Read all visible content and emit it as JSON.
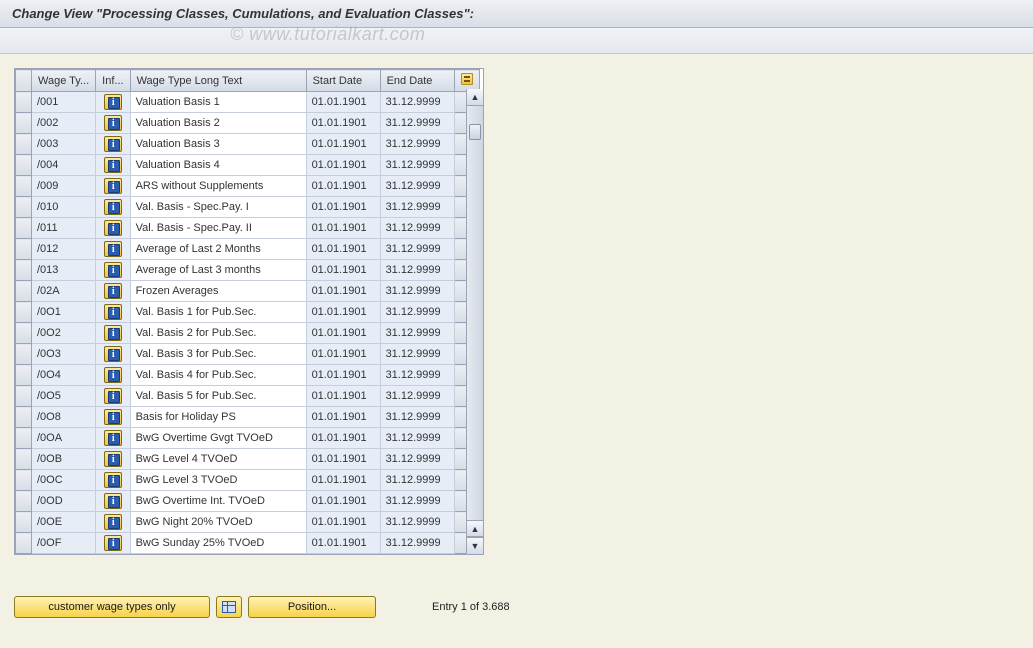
{
  "title": "Change View \"Processing Classes, Cumulations, and Evaluation Classes\":",
  "watermark": "© www.tutorialkart.com",
  "columns": {
    "wage_type": "Wage Ty...",
    "info": "Inf...",
    "long_text": "Wage Type Long Text",
    "start_date": "Start Date",
    "end_date": "End Date"
  },
  "rows": [
    {
      "wt": "/001",
      "txt": "Valuation Basis 1",
      "sd": "01.01.1901",
      "ed": "31.12.9999"
    },
    {
      "wt": "/002",
      "txt": "Valuation Basis 2",
      "sd": "01.01.1901",
      "ed": "31.12.9999"
    },
    {
      "wt": "/003",
      "txt": "Valuation Basis 3",
      "sd": "01.01.1901",
      "ed": "31.12.9999"
    },
    {
      "wt": "/004",
      "txt": "Valuation Basis 4",
      "sd": "01.01.1901",
      "ed": "31.12.9999"
    },
    {
      "wt": "/009",
      "txt": "ARS without Supplements",
      "sd": "01.01.1901",
      "ed": "31.12.9999"
    },
    {
      "wt": "/010",
      "txt": "Val. Basis - Spec.Pay. I",
      "sd": "01.01.1901",
      "ed": "31.12.9999"
    },
    {
      "wt": "/011",
      "txt": "Val. Basis - Spec.Pay. II",
      "sd": "01.01.1901",
      "ed": "31.12.9999"
    },
    {
      "wt": "/012",
      "txt": "Average of Last 2 Months",
      "sd": "01.01.1901",
      "ed": "31.12.9999"
    },
    {
      "wt": "/013",
      "txt": "Average of Last 3 months",
      "sd": "01.01.1901",
      "ed": "31.12.9999"
    },
    {
      "wt": "/02A",
      "txt": "Frozen Averages",
      "sd": "01.01.1901",
      "ed": "31.12.9999"
    },
    {
      "wt": "/0O1",
      "txt": "Val. Basis 1 for Pub.Sec.",
      "sd": "01.01.1901",
      "ed": "31.12.9999"
    },
    {
      "wt": "/0O2",
      "txt": "Val. Basis 2 for Pub.Sec.",
      "sd": "01.01.1901",
      "ed": "31.12.9999"
    },
    {
      "wt": "/0O3",
      "txt": "Val. Basis 3 for Pub.Sec.",
      "sd": "01.01.1901",
      "ed": "31.12.9999"
    },
    {
      "wt": "/0O4",
      "txt": "Val. Basis 4 for Pub.Sec.",
      "sd": "01.01.1901",
      "ed": "31.12.9999"
    },
    {
      "wt": "/0O5",
      "txt": "Val. Basis 5 for Pub.Sec.",
      "sd": "01.01.1901",
      "ed": "31.12.9999"
    },
    {
      "wt": "/0O8",
      "txt": "Basis for Holiday PS",
      "sd": "01.01.1901",
      "ed": "31.12.9999"
    },
    {
      "wt": "/0OA",
      "txt": "BwG Overtime Gvgt TVOeD",
      "sd": "01.01.1901",
      "ed": "31.12.9999"
    },
    {
      "wt": "/0OB",
      "txt": "BwG Level 4 TVOeD",
      "sd": "01.01.1901",
      "ed": "31.12.9999"
    },
    {
      "wt": "/0OC",
      "txt": "BwG Level 3 TVOeD",
      "sd": "01.01.1901",
      "ed": "31.12.9999"
    },
    {
      "wt": "/0OD",
      "txt": "BwG Overtime Int. TVOeD",
      "sd": "01.01.1901",
      "ed": "31.12.9999"
    },
    {
      "wt": "/0OE",
      "txt": "BwG Night 20% TVOeD",
      "sd": "01.01.1901",
      "ed": "31.12.9999"
    },
    {
      "wt": "/0OF",
      "txt": "BwG Sunday 25% TVOeD",
      "sd": "01.01.1901",
      "ed": "31.12.9999"
    }
  ],
  "footer": {
    "customer_btn": "customer wage types only",
    "position_btn": "Position...",
    "entry_label": "Entry 1 of 3.688"
  }
}
